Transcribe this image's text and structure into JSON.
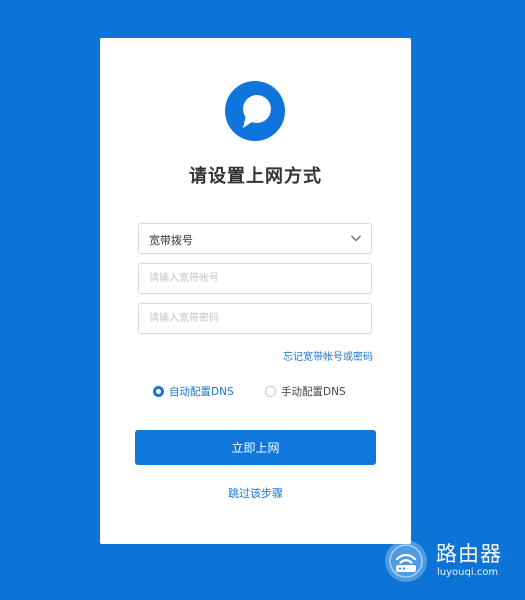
{
  "setup": {
    "title": "请设置上网方式",
    "connection_type": {
      "selected": "宽带拨号"
    },
    "account_placeholder": "请输入宽带帐号",
    "password_placeholder": "请输入宽带密码",
    "forgot_link": "忘记宽带帐号或密码",
    "dns_options": [
      {
        "label": "自动配置DNS",
        "checked": true
      },
      {
        "label": "手动配置DNS",
        "checked": false
      }
    ],
    "connect_button": "立即上网",
    "skip_link": "跳过该步骤"
  },
  "watermark": {
    "title": "路由器",
    "url": "luyouqi.com"
  },
  "colors": {
    "background": "#0c74d6",
    "card": "#ffffff",
    "accent": "#1677d6",
    "button": "#0f76dc",
    "title_text": "#333333",
    "border": "#d9d9d9"
  },
  "icons": {
    "logo": "router-logo-icon",
    "select_arrow": "chevron-down-icon",
    "watermark": "wifi-badge-icon"
  }
}
